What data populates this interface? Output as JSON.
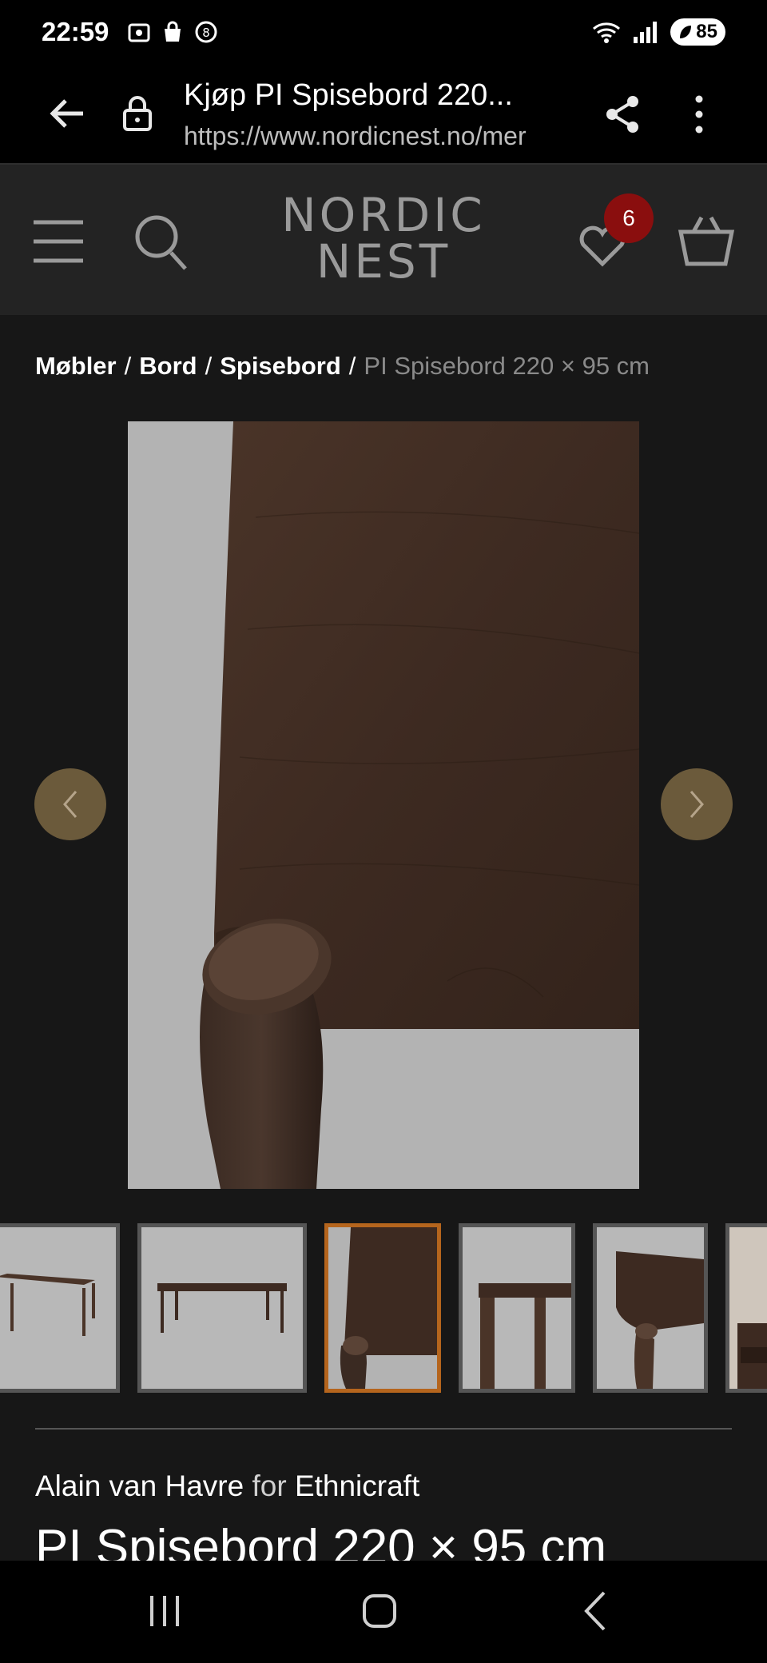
{
  "status_bar": {
    "time": "22:59",
    "battery": "85"
  },
  "browser": {
    "page_title": "Kjøp PI Spisebord 220...",
    "url": "https://www.nordicnest.no/mer"
  },
  "header": {
    "logo_line1": "NORDIC",
    "logo_line2": "NEST",
    "wishlist_count": "6"
  },
  "breadcrumb": {
    "items": [
      "Møbler",
      "Bord",
      "Spisebord"
    ],
    "separator": "/",
    "current": "PI Spisebord 220 × 95 cm"
  },
  "product": {
    "designer": "Alain van Havre",
    "for_word": "for",
    "brand": "Ethnicraft",
    "title": "PI Spisebord 220 × 95 cm"
  },
  "colors": {
    "background": "#171717",
    "header": "#232323",
    "arrow": "#6b5a3b",
    "badge": "#8a0e0e",
    "active_thumb_border": "#b5651d"
  },
  "icons": [
    "back-arrow-icon",
    "lock-icon",
    "share-icon",
    "more-vert-icon",
    "menu-icon",
    "search-icon",
    "heart-icon",
    "basket-icon",
    "chevron-left-icon",
    "chevron-right-icon",
    "recent-apps-icon",
    "home-icon",
    "nav-back-icon"
  ]
}
